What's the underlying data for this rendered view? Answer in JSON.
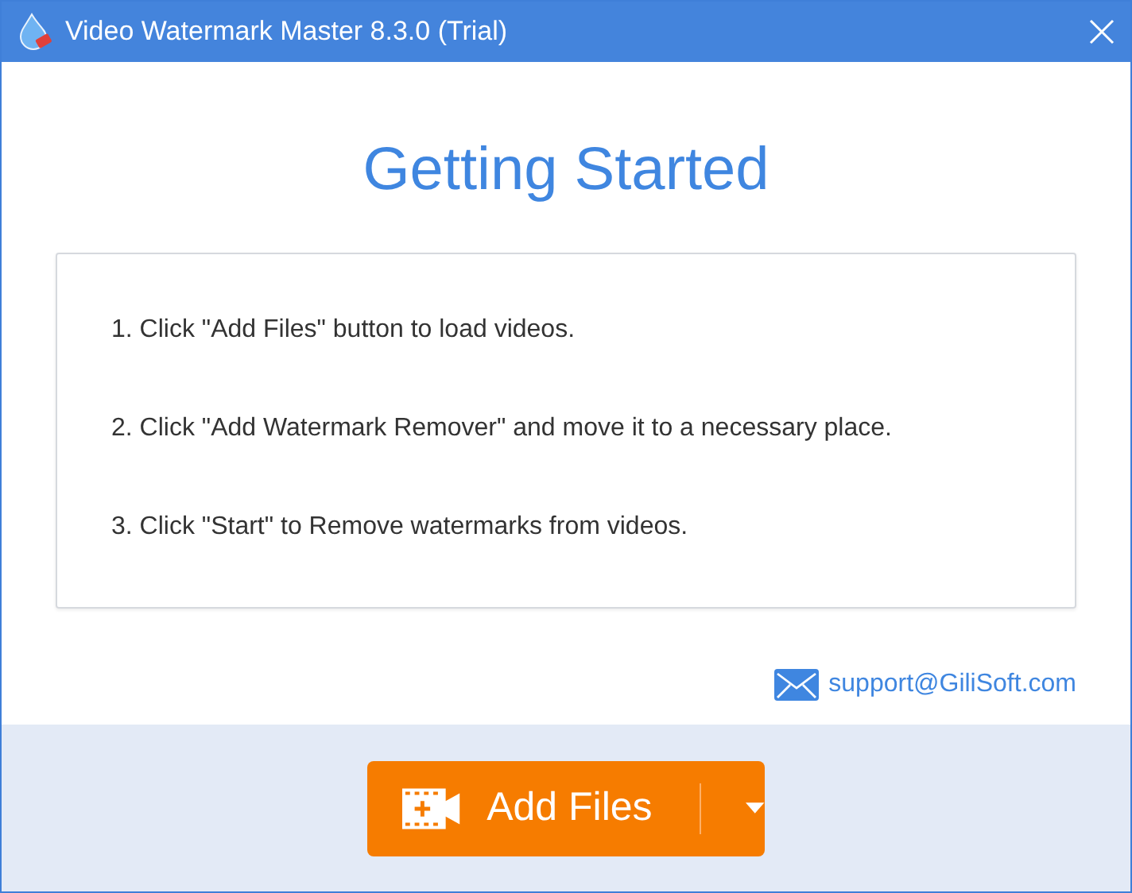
{
  "window": {
    "title": "Video Watermark Master 8.3.0 (Trial)"
  },
  "heading": "Getting Started",
  "steps": [
    "1. Click \"Add Files\" button to load videos.",
    "2. Click \"Add Watermark Remover\" and move it to a necessary place.",
    "3. Click \"Start\" to Remove watermarks from videos."
  ],
  "support_link": "support@GiliSoft.com",
  "add_button": {
    "label": "Add Files"
  }
}
